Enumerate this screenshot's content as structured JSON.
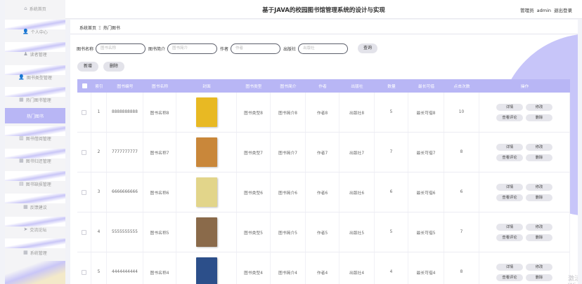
{
  "header": {
    "title": "基于JAVA的校园图书馆管理系统的设计与实现",
    "role": "管理员",
    "username": "admin",
    "logout": "退出登录"
  },
  "sidebar": {
    "items": [
      {
        "label": "系统首页",
        "icon": "home-icon"
      },
      {
        "label": "个人中心",
        "icon": "user-icon"
      },
      {
        "label": "读者管理",
        "icon": "reader-icon"
      },
      {
        "label": "图书类型管理",
        "icon": "user-icon"
      },
      {
        "label": "热门图书管理",
        "icon": "grid-icon"
      },
      {
        "label": "热门图书",
        "icon": "",
        "active": true
      },
      {
        "label": "图书借阅管理",
        "icon": "chart-icon"
      },
      {
        "label": "图书归还管理",
        "icon": "grid-icon"
      },
      {
        "label": "图书缺损管理",
        "icon": "doc-icon"
      },
      {
        "label": "反馈建议",
        "icon": "grid-icon"
      },
      {
        "label": "交流论坛",
        "icon": "send-icon"
      },
      {
        "label": "系统管理",
        "icon": "grid-icon"
      }
    ]
  },
  "breadcrumb": {
    "home": "系统首页",
    "separator": "Ξ",
    "current": "热门图书"
  },
  "search": {
    "fields": [
      {
        "label": "图书名称",
        "placeholder": "图书名称"
      },
      {
        "label": "图书简介",
        "placeholder": "图书简介"
      },
      {
        "label": "作者",
        "placeholder": "作者"
      },
      {
        "label": "出版社",
        "placeholder": "出版社"
      }
    ],
    "query_label": "查询"
  },
  "actions": {
    "add_label": "新增",
    "delete_label": "删除"
  },
  "table": {
    "columns": [
      "",
      "索引",
      "图书编号",
      "图书名称",
      "封面",
      "图书类型",
      "图书简介",
      "作者",
      "出版社",
      "数量",
      "最长可借",
      "点击次数",
      "操作"
    ],
    "rows": [
      {
        "index": "1",
        "code": "8888888888",
        "name": "图书名称8",
        "cover_color": "#e8b923",
        "type": "图书类型8",
        "intro": "图书简介8",
        "author": "作者8",
        "publisher": "出版社8",
        "qty": "5",
        "maxborrow": "最长可借8",
        "clicks": "10"
      },
      {
        "index": "2",
        "code": "7777777777",
        "name": "图书名称7",
        "cover_color": "#c9873a",
        "type": "图书类型7",
        "intro": "图书简介7",
        "author": "作者7",
        "publisher": "出版社7",
        "qty": "7",
        "maxborrow": "最长可借7",
        "clicks": "8"
      },
      {
        "index": "3",
        "code": "6666666666",
        "name": "图书名称6",
        "cover_color": "#e2d58a",
        "type": "图书类型6",
        "intro": "图书简介6",
        "author": "作者6",
        "publisher": "出版社6",
        "qty": "6",
        "maxborrow": "最长可借6",
        "clicks": "6"
      },
      {
        "index": "4",
        "code": "5555555555",
        "name": "图书名称5",
        "cover_color": "#8a6a4a",
        "type": "图书类型5",
        "intro": "图书简介5",
        "author": "作者5",
        "publisher": "出版社5",
        "qty": "5",
        "maxborrow": "最长可借5",
        "clicks": "7"
      },
      {
        "index": "5",
        "code": "4444444444",
        "name": "图书名称4",
        "cover_color": "#2c4f8a",
        "type": "图书类型4",
        "intro": "图书简介4",
        "author": "作者4",
        "publisher": "出版社4",
        "qty": "4",
        "maxborrow": "最长可借4",
        "clicks": "8"
      }
    ],
    "op_labels": {
      "detail": "详情",
      "edit": "修改",
      "comments": "查看评论",
      "delete": "删除"
    }
  },
  "colors": {
    "accent": "#b8b6f5",
    "sidebar_stripe": "#c9c6f7"
  }
}
